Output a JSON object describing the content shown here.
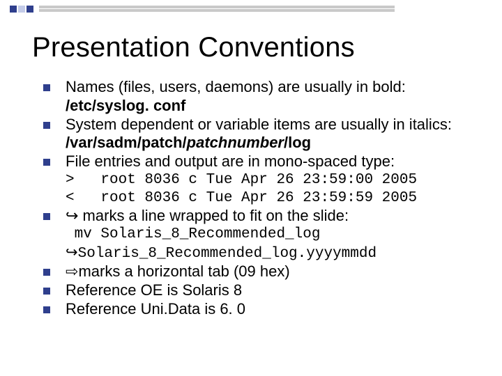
{
  "slide": {
    "title": "Presentation Conventions",
    "b1": {
      "text": "Names (files, users, daemons) are usually in bold:",
      "example": "/etc/syslog. conf"
    },
    "b2": {
      "text": "System dependent or variable items are usually in italics:",
      "ex_pre": " /var/sadm/patch/",
      "ex_var": "patchnumber",
      "ex_post": "/log"
    },
    "b3": {
      "text": "File entries and output are in mono-spaced type:",
      "line1": ">   root 8036 c Tue Apr 26 23:59:00 2005",
      "line2": "<   root 8036 c Tue Apr 26 23:59:59 2005"
    },
    "b4": {
      "sym": "↪",
      "text": " marks a line wrapped to fit on the slide:",
      "code1": " mv Solaris_8_Recommended_log",
      "code2_sym": "↪",
      "code2": "Solaris_8_Recommended_log.yyyymmdd"
    },
    "b5": {
      "sym": "⇨",
      "text": "marks a horizontal tab (09 hex)"
    },
    "b6": {
      "text": "Reference OE is Solaris 8"
    },
    "b7": {
      "text": "Reference Uni.Data is 6. 0"
    }
  }
}
